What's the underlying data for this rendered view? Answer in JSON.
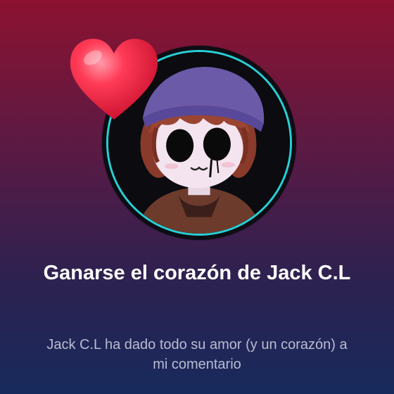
{
  "achievement": {
    "title": "Ganarse el corazón de Jack C.L",
    "description": "Jack C.L ha dado todo su amor (y un corazón) a mi comentario",
    "avatar_icon": "avatar-image",
    "badge_icon": "heart-icon",
    "avatar_signature": "Jack_CL"
  },
  "colors": {
    "background_top": "#8c1230",
    "background_bottom": "#172a5c",
    "avatar_ring": "#27d0d6",
    "heart": "#ff2a4a",
    "title_text": "#ffffff",
    "description_text": "#b9bcd2"
  }
}
